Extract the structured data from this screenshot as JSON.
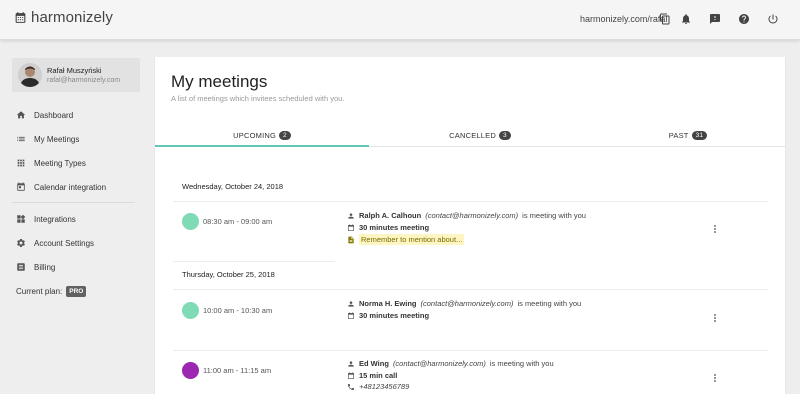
{
  "app": {
    "name": "harmonizely"
  },
  "topbar": {
    "url": "harmonizely.com/rafal"
  },
  "user": {
    "name": "Rafał Muszyński",
    "email": "rafal@harmonizely.com"
  },
  "nav": {
    "items": [
      {
        "label": "Dashboard",
        "icon": "home-icon"
      },
      {
        "label": "My Meetings",
        "icon": "list-icon"
      },
      {
        "label": "Meeting Types",
        "icon": "grid-icon"
      },
      {
        "label": "Calendar integration",
        "icon": "calendar-icon"
      },
      {
        "label": "Integrations",
        "icon": "widgets-icon"
      },
      {
        "label": "Account Settings",
        "icon": "gear-icon"
      },
      {
        "label": "Billing",
        "icon": "billing-icon"
      }
    ],
    "plan_label": "Current plan:",
    "plan_badge": "PRO"
  },
  "main": {
    "title": "My meetings",
    "subtitle": "A list of meetings which invitees scheduled with you.",
    "tabs": [
      {
        "label": "UPCOMING",
        "count": "2",
        "active": true
      },
      {
        "label": "CANCELLED",
        "count": "3",
        "active": false
      },
      {
        "label": "PAST",
        "count": "31",
        "active": false
      }
    ],
    "accent_color": "#5fc7b3",
    "groups": [
      {
        "date": "Wednesday, October 24, 2018",
        "meetings": [
          {
            "time": "08:30 am - 09:00 am",
            "color": "#7fdbb6",
            "invitee": "Ralph A. Calhoun",
            "contact": "(contact@harmonizely.com)",
            "suffix": "is meeting with you",
            "type": "30 minutes meeting",
            "note": "Remember to mention about..."
          }
        ]
      },
      {
        "date": "Thursday, October 25, 2018",
        "meetings": [
          {
            "time": "10:00 am - 10:30 am",
            "color": "#7fdbb6",
            "invitee": "Norma H. Ewing",
            "contact": "(contact@harmonizely.com)",
            "suffix": "is meeting with you",
            "type": "30 minutes meeting"
          },
          {
            "time": "11:00 am - 11:15 am",
            "color": "#9c27b0",
            "invitee": "Ed Wing",
            "contact": "(contact@harmonizely.com)",
            "suffix": "is meeting with you",
            "type": "15 min call",
            "phone": "+48123456789"
          }
        ]
      }
    ]
  }
}
